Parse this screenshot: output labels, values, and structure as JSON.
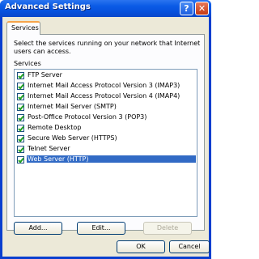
{
  "window": {
    "title": "Advanced Settings",
    "help_glyph": "?",
    "close_glyph": "✕"
  },
  "tabs": [
    {
      "label": "Services"
    }
  ],
  "panel": {
    "description": "Select the services running on your network that Internet users can access.",
    "services_heading": "Services",
    "services": [
      {
        "label": "FTP Server",
        "checked": true,
        "selected": false
      },
      {
        "label": "Internet Mail Access Protocol Version 3 (IMAP3)",
        "checked": true,
        "selected": false
      },
      {
        "label": "Internet Mail Access Protocol Version 4 (IMAP4)",
        "checked": true,
        "selected": false
      },
      {
        "label": "Internet Mail Server (SMTP)",
        "checked": true,
        "selected": false
      },
      {
        "label": "Post-Office Protocol Version 3 (POP3)",
        "checked": true,
        "selected": false
      },
      {
        "label": "Remote Desktop",
        "checked": true,
        "selected": false
      },
      {
        "label": "Secure Web Server (HTTPS)",
        "checked": true,
        "selected": false
      },
      {
        "label": "Telnet Server",
        "checked": true,
        "selected": false
      },
      {
        "label": "Web Server (HTTP)",
        "checked": true,
        "selected": true
      }
    ],
    "buttons": {
      "add": "Add...",
      "edit": "Edit...",
      "delete": "Delete"
    }
  },
  "footer": {
    "ok": "OK",
    "cancel": "Cancel"
  },
  "colors": {
    "selection": "#316ac5",
    "titlebar": "#0b5be6",
    "face": "#ece9d8"
  }
}
